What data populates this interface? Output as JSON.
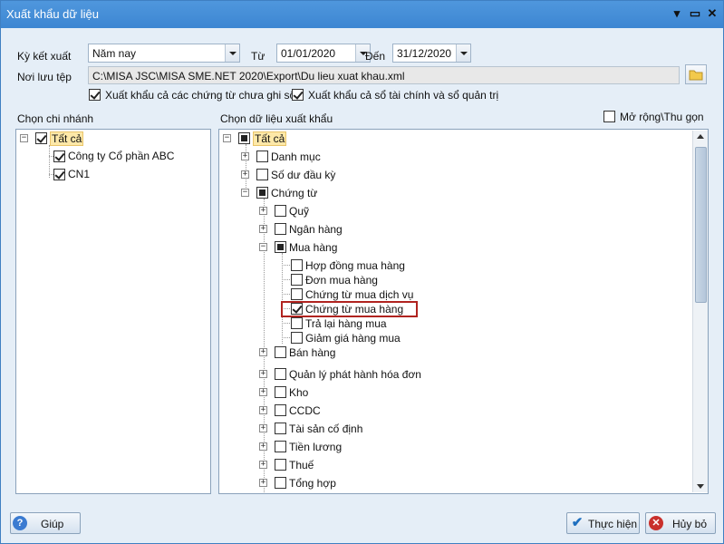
{
  "window": {
    "title": "Xuất khẩu dữ liệu"
  },
  "filters": {
    "period_label": "Kỳ kết xuất",
    "period_value": "Năm nay",
    "from_label": "Từ",
    "from_value": "01/01/2020",
    "to_label": "Đến",
    "to_value": "31/12/2020",
    "save_label": "Nơi lưu tệp",
    "save_path": "C:\\MISA JSC\\MISA SME.NET 2020\\Export\\Du lieu xuat khau.xml",
    "opt_unposted": "Xuất khẩu cả các chứng từ chưa ghi sổ",
    "opt_finance": "Xuất khẩu cả sổ tài chính và sổ quản trị"
  },
  "branch_panel": {
    "title": "Chọn chi nhánh",
    "nodes": [
      "Tất cả",
      "Công ty Cổ phần ABC",
      "CN1"
    ]
  },
  "data_panel": {
    "title": "Chọn dữ liệu xuất khẩu",
    "expand_collapse": "Mở rộng\\Thu gọn",
    "root": "Tất cả",
    "level1": [
      "Danh mục",
      "Số dư đầu kỳ",
      "Chứng từ"
    ],
    "vouchers": [
      "Quỹ",
      "Ngân hàng",
      "Mua hàng",
      "Bán hàng",
      "Quản lý phát hành hóa đơn",
      "Kho",
      "CCDC",
      "Tài sản cố định",
      "Tiền lương",
      "Thuế",
      "Tổng hợp"
    ],
    "purchase": [
      "Hợp đồng mua hàng",
      "Đơn mua hàng",
      "Chứng từ mua dịch vụ",
      "Chứng từ mua hàng",
      "Trả lại hàng mua",
      "Giảm giá hàng mua"
    ]
  },
  "footer": {
    "help": "Giúp",
    "execute": "Thực hiện",
    "cancel": "Hủy bỏ"
  },
  "colors": {
    "title_bar": "#4a92da",
    "highlight": "#b0231f",
    "window_bg": "#e5eef7"
  }
}
